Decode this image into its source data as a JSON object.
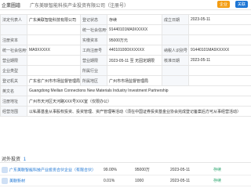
{
  "header": {
    "label": "企業圖譜",
    "title": "广东美联智能科技产业投资有限公司（注册号）",
    "tag": "风险提示",
    "badges": [
      "企业",
      "关联"
    ]
  },
  "info": {
    "rows": [
      {
        "k1": "法定代表人",
        "v1": "广东美联智能科技有限公司",
        "k2": "登记状态",
        "v2": "存续",
        "k3": "成立日期",
        "v3": "2023-05-11"
      },
      {
        "k1": "",
        "v1": "",
        "k2": "统一社会信用代码",
        "v2": "91440101MA9XXXXX",
        "k3": "",
        "v3": ""
      },
      {
        "k1": "注册资本",
        "v1": "",
        "k2": "实缴资本",
        "v2": "95000万元",
        "k3": "",
        "v3": ""
      },
      {
        "k1": "统一社会信用代码",
        "v1": "MA9XXXXX",
        "k2": "工商注册号",
        "v2": "440101000XXXXXX",
        "k3": "纳税人识别号",
        "v3": "91440101MA9XXXXX"
      },
      {
        "k1": "营业期限",
        "v1": "",
        "k2": "营业期限",
        "v2": "2023-05-11 至 无固定期限",
        "k3": "核准日期",
        "v3": "2023-05-11"
      },
      {
        "k1": "企业类型",
        "v1": "",
        "k2": "所属行业",
        "v2": "",
        "k3": "",
        "v3": ""
      },
      {
        "k1": "登记机关",
        "v1": "广东省广州市市场监督管理局",
        "k2": "所属地区",
        "v2": "广州市市场监督管理局",
        "k3": "",
        "v3": ""
      },
      {
        "k1": "英文名",
        "v1": "",
        "k2": "Guangdong Meilian Connections New Materials Industry Investment Partnership",
        "v2": "",
        "k3": "",
        "v3": ""
      },
      {
        "k1": "注册地址",
        "v1": "广州市天河区天河路XXX号XXX室（仅限办公）",
        "k2": "",
        "v2": "",
        "k3": "",
        "v3": ""
      },
      {
        "k1": "经营范围",
        "v1": "以私募基金从事股权投资、投资管理、资产管理等活动（须在中国证券投资基金业协会完成登记备案后方可从事经营活动）",
        "k2": "",
        "v2": "",
        "k3": "",
        "v3": ""
      }
    ]
  },
  "subsection": {
    "title": "对外投资",
    "count": "1",
    "rows": [
      {
        "name": "广东美联智能科技产业投资合伙企业（有限合伙）",
        "ratio": "99.00%",
        "amount": "95000万",
        "date": "2023-05-11",
        "status": "存续"
      },
      {
        "name": "美联新材",
        "ratio": "0.01%",
        "amount": "1000",
        "date": "2023-05-11",
        "status": "存续"
      }
    ]
  }
}
